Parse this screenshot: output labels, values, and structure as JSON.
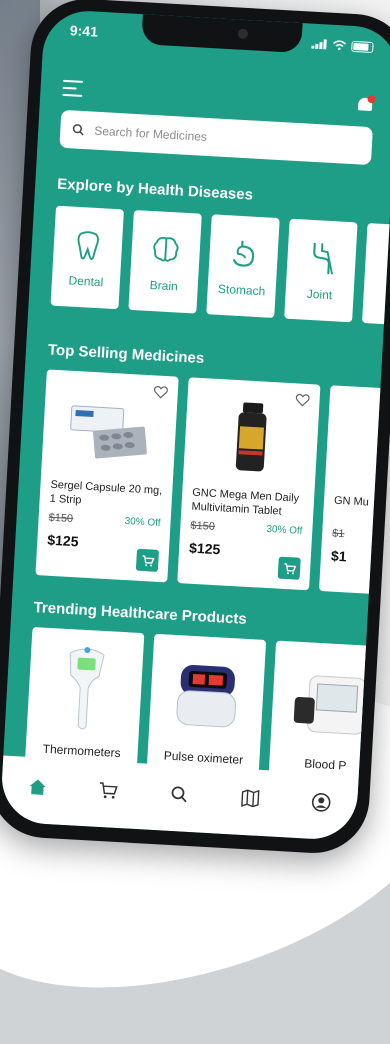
{
  "status": {
    "time": "9:41"
  },
  "search": {
    "placeholder": "Search for Medicines"
  },
  "sections": {
    "diseases": "Explore by Health Diseases",
    "top_selling": "Top Selling Medicines",
    "trending": "Trending Healthcare Products"
  },
  "diseases": [
    {
      "label": "Dental",
      "icon": "tooth-icon"
    },
    {
      "label": "Brain",
      "icon": "brain-icon"
    },
    {
      "label": "Stomach",
      "icon": "stomach-icon"
    },
    {
      "label": "Joint",
      "icon": "joint-icon"
    }
  ],
  "medicines": [
    {
      "name": "Sergel Capsule 20 mg, 1 Strip",
      "old_price": "$150",
      "discount": "30% Off",
      "price": "$125",
      "icon": "capsule-strip-icon"
    },
    {
      "name": "GNC Mega Men Daily Multivitamin Tablet",
      "old_price": "$150",
      "discount": "30% Off",
      "price": "$125",
      "icon": "vitamin-bottle-icon"
    },
    {
      "name": "GN Mu",
      "old_price": "$1",
      "discount": "",
      "price": "$1",
      "icon": "vitamin-bottle-icon"
    }
  ],
  "products": [
    {
      "label": "Thermometers",
      "icon": "thermometer-icon"
    },
    {
      "label": "Pulse oximeter",
      "icon": "oximeter-icon"
    },
    {
      "label": "Blood P",
      "icon": "blood-pressure-monitor-icon"
    }
  ],
  "tabs": [
    {
      "name": "home",
      "icon": "home-icon"
    },
    {
      "name": "cart",
      "icon": "cart-icon"
    },
    {
      "name": "search",
      "icon": "search-icon"
    },
    {
      "name": "map",
      "icon": "map-icon"
    },
    {
      "name": "profile",
      "icon": "profile-icon"
    }
  ],
  "colors": {
    "primary": "#1f9e87",
    "notification": "#e53935",
    "tab_active": "#1f9e87",
    "tab_inactive": "#333333"
  }
}
